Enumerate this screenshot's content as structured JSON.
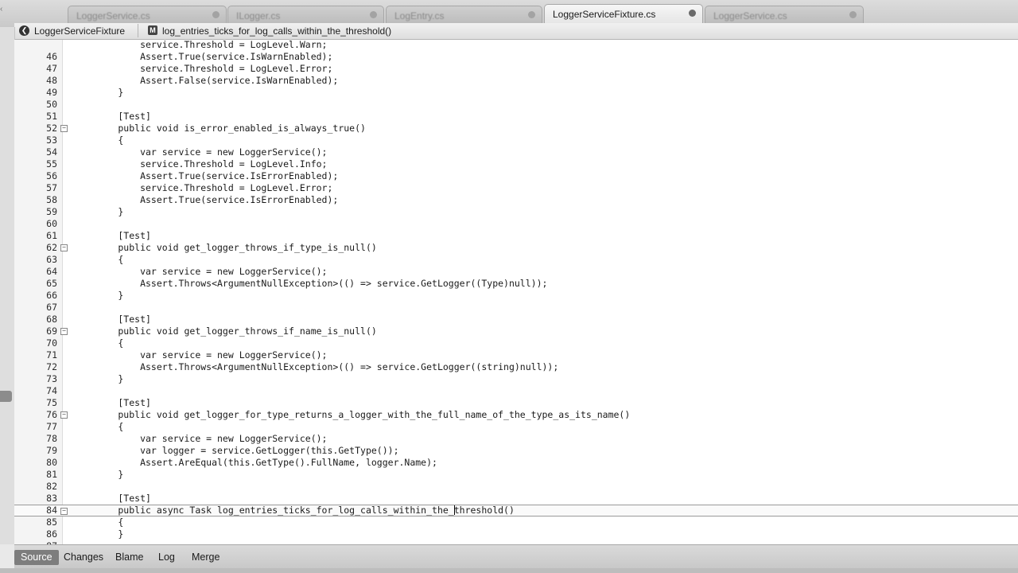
{
  "tabs": [
    {
      "label": "LoggerService.cs",
      "active": false
    },
    {
      "label": "ILogger.cs",
      "active": false
    },
    {
      "label": "LogEntry.cs",
      "active": false
    },
    {
      "label": "LoggerServiceFixture.cs",
      "active": true
    },
    {
      "label": "LoggerService.cs",
      "active": false
    }
  ],
  "breadcrumb": {
    "file": "LoggerServiceFixture",
    "method_icon": "M",
    "method": "log_entries_ticks_for_log_calls_within_the_threshold()"
  },
  "lines": [
    {
      "n": "",
      "text": "            service.Threshold = LogLevel.Warn;"
    },
    {
      "n": "46",
      "text": "            Assert.True(service.IsWarnEnabled);"
    },
    {
      "n": "47",
      "text": "            service.Threshold = LogLevel.Error;"
    },
    {
      "n": "48",
      "text": "            Assert.False(service.IsWarnEnabled);"
    },
    {
      "n": "49",
      "text": "        }"
    },
    {
      "n": "50",
      "text": ""
    },
    {
      "n": "51",
      "text": "        [Test]"
    },
    {
      "n": "52",
      "text": "        public void is_error_enabled_is_always_true()",
      "fold": true
    },
    {
      "n": "53",
      "text": "        {"
    },
    {
      "n": "54",
      "text": "            var service = new LoggerService();"
    },
    {
      "n": "55",
      "text": "            service.Threshold = LogLevel.Info;"
    },
    {
      "n": "56",
      "text": "            Assert.True(service.IsErrorEnabled);"
    },
    {
      "n": "57",
      "text": "            service.Threshold = LogLevel.Error;"
    },
    {
      "n": "58",
      "text": "            Assert.True(service.IsErrorEnabled);"
    },
    {
      "n": "59",
      "text": "        }"
    },
    {
      "n": "60",
      "text": ""
    },
    {
      "n": "61",
      "text": "        [Test]"
    },
    {
      "n": "62",
      "text": "        public void get_logger_throws_if_type_is_null()",
      "fold": true
    },
    {
      "n": "63",
      "text": "        {"
    },
    {
      "n": "64",
      "text": "            var service = new LoggerService();"
    },
    {
      "n": "65",
      "text": "            Assert.Throws<ArgumentNullException>(() => service.GetLogger((Type)null));"
    },
    {
      "n": "66",
      "text": "        }"
    },
    {
      "n": "67",
      "text": ""
    },
    {
      "n": "68",
      "text": "        [Test]"
    },
    {
      "n": "69",
      "text": "        public void get_logger_throws_if_name_is_null()",
      "fold": true
    },
    {
      "n": "70",
      "text": "        {"
    },
    {
      "n": "71",
      "text": "            var service = new LoggerService();"
    },
    {
      "n": "72",
      "text": "            Assert.Throws<ArgumentNullException>(() => service.GetLogger((string)null));"
    },
    {
      "n": "73",
      "text": "        }"
    },
    {
      "n": "74",
      "text": ""
    },
    {
      "n": "75",
      "text": "        [Test]"
    },
    {
      "n": "76",
      "text": "        public void get_logger_for_type_returns_a_logger_with_the_full_name_of_the_type_as_its_name()",
      "fold": true
    },
    {
      "n": "77",
      "text": "        {"
    },
    {
      "n": "78",
      "text": "            var service = new LoggerService();"
    },
    {
      "n": "79",
      "text": "            var logger = service.GetLogger(this.GetType());"
    },
    {
      "n": "80",
      "text": "            Assert.AreEqual(this.GetType().FullName, logger.Name);"
    },
    {
      "n": "81",
      "text": "        }"
    },
    {
      "n": "82",
      "text": ""
    },
    {
      "n": "83",
      "text": "        [Test]"
    },
    {
      "n": "84",
      "text": "        public async Task log_entries_ticks_for_log_calls_within_the_threshold()",
      "fold": true,
      "current": true
    },
    {
      "n": "85",
      "text": "        {"
    },
    {
      "n": "86",
      "text": "        }"
    },
    {
      "n": "87",
      "text": ""
    }
  ],
  "bottom_tabs": [
    {
      "label": "Source",
      "active": true
    },
    {
      "label": "Changes",
      "active": false
    },
    {
      "label": "Blame",
      "active": false
    },
    {
      "label": "Log",
      "active": false
    },
    {
      "label": "Merge",
      "active": false
    }
  ],
  "icons": {
    "tab_close": "dot-icon",
    "fold": "fold-minus-icon",
    "breadcrumb_file": "chevron-left-icon",
    "breadcrumb_method": "method-icon"
  },
  "colors": {
    "editor_bg": "#ffffff",
    "gutter_bg": "#f4f4f4",
    "active_bottom_tab": "#7d7d7d"
  }
}
